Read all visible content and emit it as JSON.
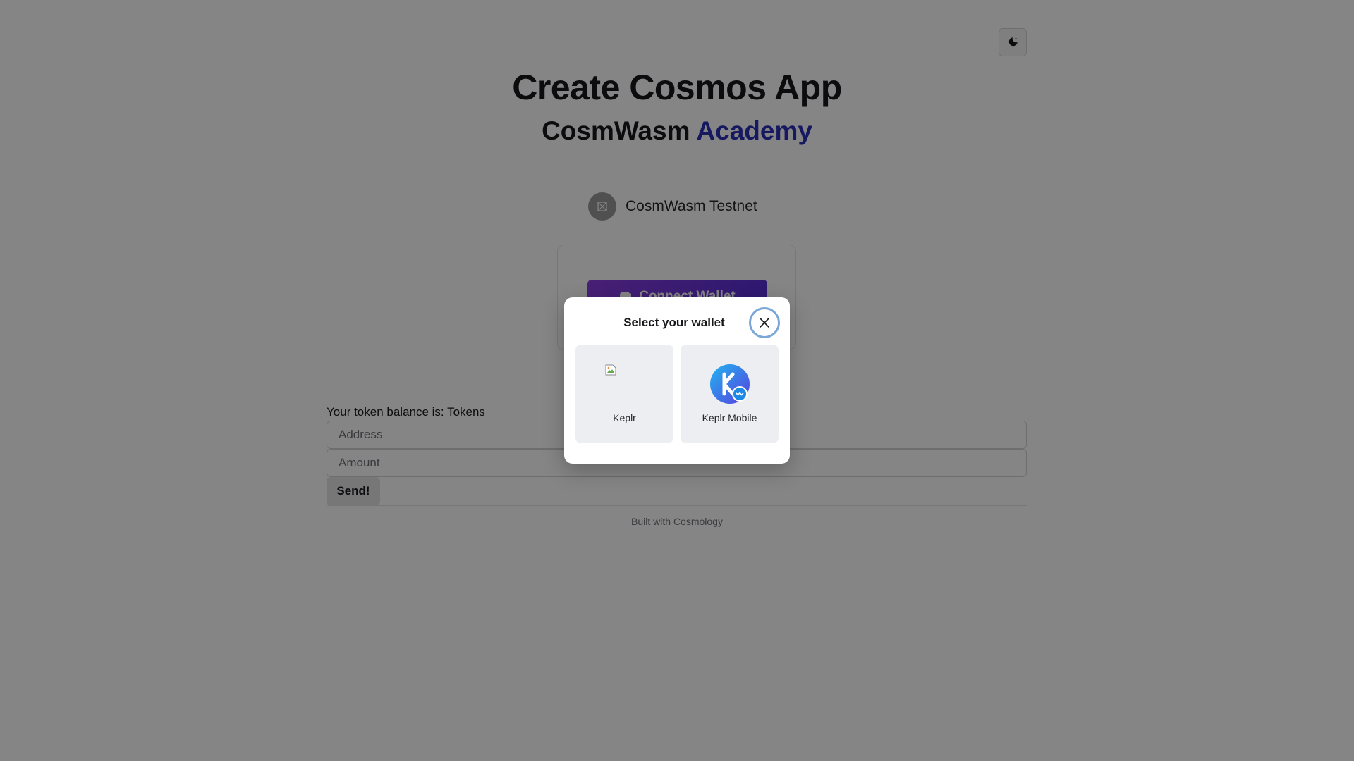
{
  "header": {
    "title": "Create Cosmos App",
    "subtitle_main": "CosmWasm",
    "subtitle_accent": "Academy",
    "theme_toggle_icon": "moon-icon"
  },
  "chain": {
    "name": "CosmWasm Testnet",
    "logo_icon": "chain-placeholder-icon"
  },
  "wallet_card": {
    "connect_label": "Connect Wallet",
    "connect_icon": "wallet-icon"
  },
  "form": {
    "balance_text": "Your token balance is: Tokens",
    "address_placeholder": "Address",
    "amount_placeholder": "Amount",
    "send_label": "Send!"
  },
  "footer": {
    "text": "Built with Cosmology"
  },
  "modal": {
    "title": "Select your wallet",
    "close_icon": "close-icon",
    "wallets": [
      {
        "label": "Keplr",
        "icon": "broken-image-icon"
      },
      {
        "label": "Keplr Mobile",
        "icon": "keplr-mobile-logo-icon"
      }
    ]
  },
  "colors": {
    "accent": "#2b2eb8",
    "connect_gradient_start": "#8a3fe0",
    "connect_gradient_end": "#5a2fd8",
    "keplr_blue": "#1e88e5",
    "overlay": "rgba(0,0,0,0.48)"
  }
}
